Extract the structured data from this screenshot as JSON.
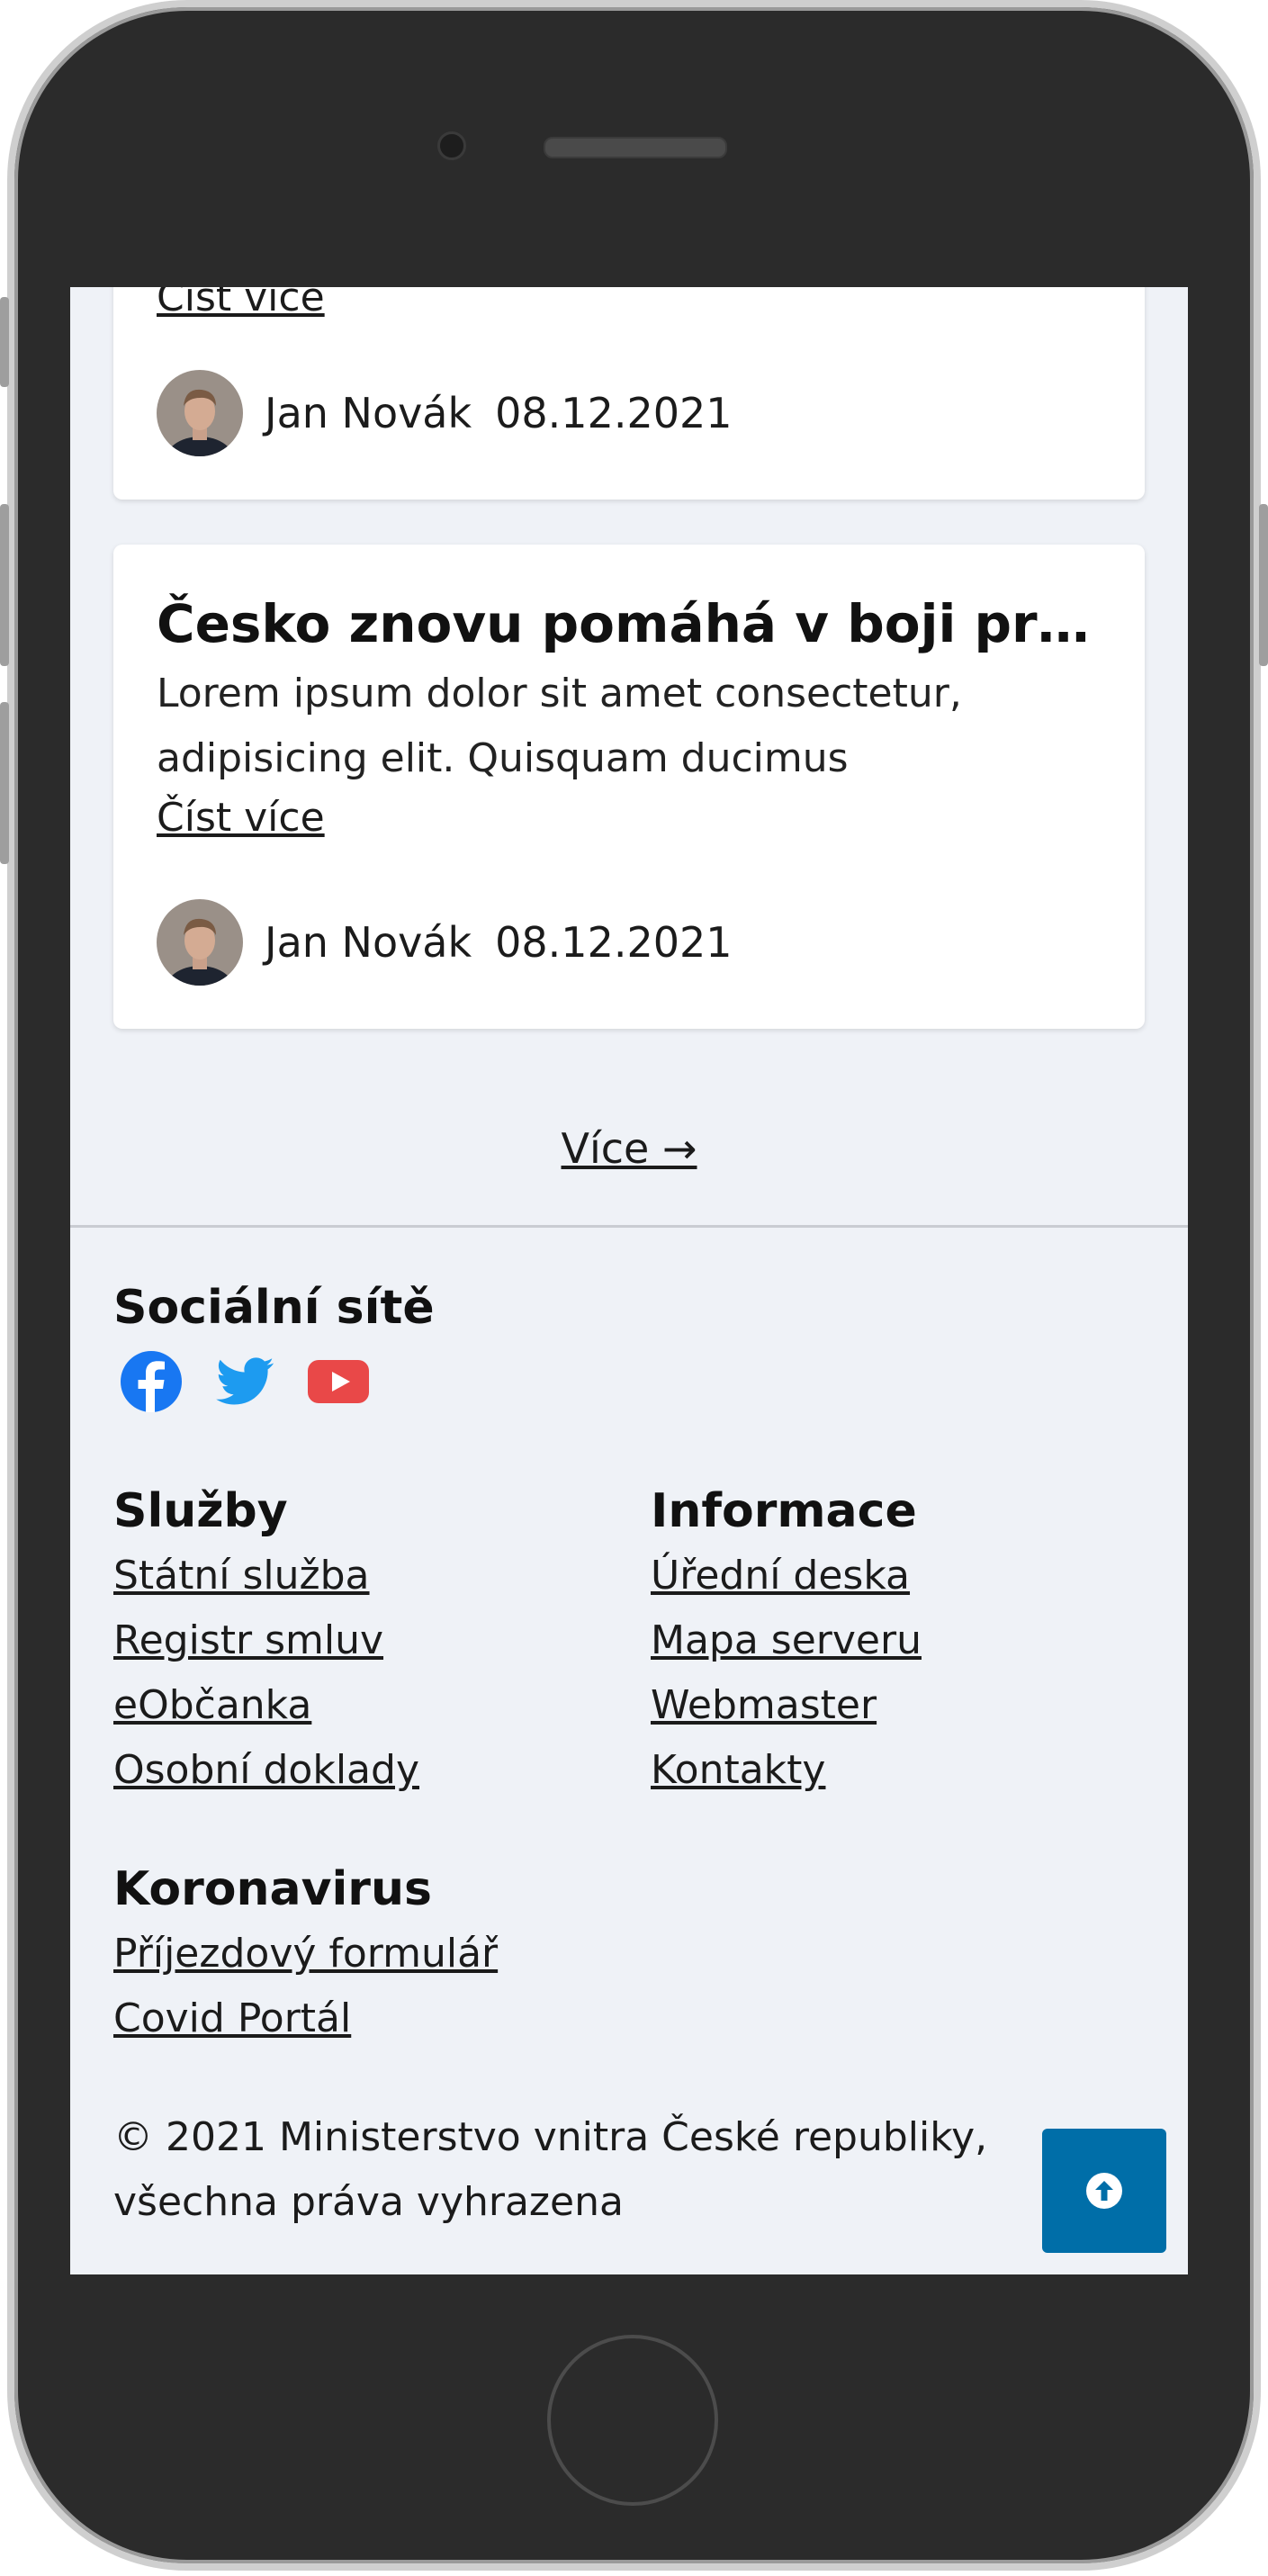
{
  "articles": [
    {
      "read_more": "Číst více",
      "author": "Jan Novák",
      "date": "08.12.2021"
    },
    {
      "title": "Česko znovu pomáhá v boji proti koronaviru",
      "text": "Lorem ipsum dolor sit amet consectetur, adipisicing elit. Quisquam ducimus",
      "read_more": "Číst více",
      "author": "Jan Novák",
      "date": "08.12.2021"
    }
  ],
  "more_link": "Více →",
  "footer": {
    "social": {
      "heading": "Sociální sítě",
      "icons": [
        "facebook-icon",
        "twitter-icon",
        "youtube-icon"
      ]
    },
    "services": {
      "heading": "Služby",
      "links": [
        "Státní služba",
        "Registr smluv",
        "eObčanka",
        "Osobní doklady"
      ]
    },
    "information": {
      "heading": "Informace",
      "links": [
        "Úřední deska",
        "Mapa serveru",
        "Webmaster",
        "Kontakty"
      ]
    },
    "coronavirus": {
      "heading": "Koronavirus",
      "links": [
        "Příjezdový formulář",
        "Covid Portál"
      ]
    },
    "copyright": "© 2021 Ministerstvo vnitra České republiky, všechna práva vyhrazena"
  },
  "colors": {
    "page_background": "#eff2f7",
    "accent": "#006ea8",
    "facebook": "#1877f2",
    "twitter": "#1d9bf0",
    "youtube": "#e94848"
  }
}
